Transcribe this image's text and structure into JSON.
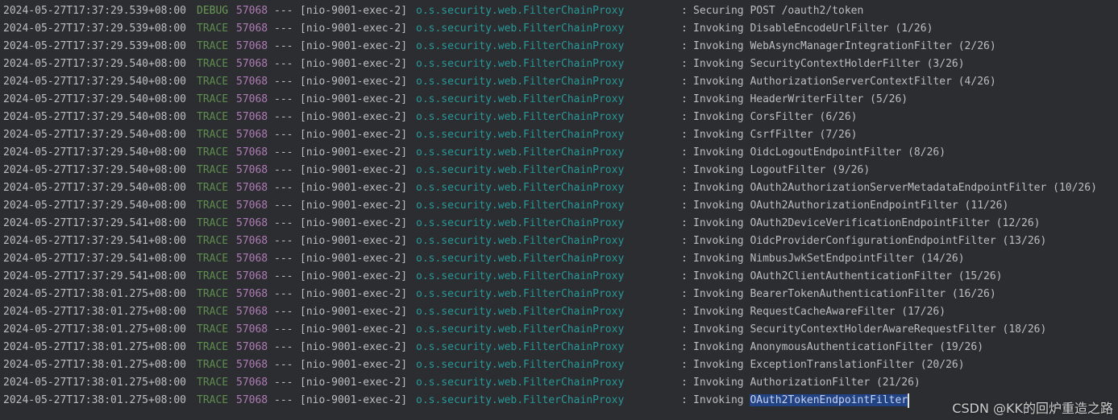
{
  "console": {
    "lines": [
      {
        "timestamp": "2024-05-27T17:37:29.539+08:00",
        "level": "DEBUG",
        "pid": "57068",
        "sep": "---",
        "thread": "[nio-9001-exec-2]",
        "logger": "o.s.security.web.FilterChainProxy",
        "colon": ":",
        "message": "Securing POST /oauth2/token"
      },
      {
        "timestamp": "2024-05-27T17:37:29.539+08:00",
        "level": "TRACE",
        "pid": "57068",
        "sep": "---",
        "thread": "[nio-9001-exec-2]",
        "logger": "o.s.security.web.FilterChainProxy",
        "colon": ":",
        "message": "Invoking DisableEncodeUrlFilter (1/26)"
      },
      {
        "timestamp": "2024-05-27T17:37:29.539+08:00",
        "level": "TRACE",
        "pid": "57068",
        "sep": "---",
        "thread": "[nio-9001-exec-2]",
        "logger": "o.s.security.web.FilterChainProxy",
        "colon": ":",
        "message": "Invoking WebAsyncManagerIntegrationFilter (2/26)"
      },
      {
        "timestamp": "2024-05-27T17:37:29.540+08:00",
        "level": "TRACE",
        "pid": "57068",
        "sep": "---",
        "thread": "[nio-9001-exec-2]",
        "logger": "o.s.security.web.FilterChainProxy",
        "colon": ":",
        "message": "Invoking SecurityContextHolderFilter (3/26)"
      },
      {
        "timestamp": "2024-05-27T17:37:29.540+08:00",
        "level": "TRACE",
        "pid": "57068",
        "sep": "---",
        "thread": "[nio-9001-exec-2]",
        "logger": "o.s.security.web.FilterChainProxy",
        "colon": ":",
        "message": "Invoking AuthorizationServerContextFilter (4/26)"
      },
      {
        "timestamp": "2024-05-27T17:37:29.540+08:00",
        "level": "TRACE",
        "pid": "57068",
        "sep": "---",
        "thread": "[nio-9001-exec-2]",
        "logger": "o.s.security.web.FilterChainProxy",
        "colon": ":",
        "message": "Invoking HeaderWriterFilter (5/26)"
      },
      {
        "timestamp": "2024-05-27T17:37:29.540+08:00",
        "level": "TRACE",
        "pid": "57068",
        "sep": "---",
        "thread": "[nio-9001-exec-2]",
        "logger": "o.s.security.web.FilterChainProxy",
        "colon": ":",
        "message": "Invoking CorsFilter (6/26)"
      },
      {
        "timestamp": "2024-05-27T17:37:29.540+08:00",
        "level": "TRACE",
        "pid": "57068",
        "sep": "---",
        "thread": "[nio-9001-exec-2]",
        "logger": "o.s.security.web.FilterChainProxy",
        "colon": ":",
        "message": "Invoking CsrfFilter (7/26)"
      },
      {
        "timestamp": "2024-05-27T17:37:29.540+08:00",
        "level": "TRACE",
        "pid": "57068",
        "sep": "---",
        "thread": "[nio-9001-exec-2]",
        "logger": "o.s.security.web.FilterChainProxy",
        "colon": ":",
        "message": "Invoking OidcLogoutEndpointFilter (8/26)"
      },
      {
        "timestamp": "2024-05-27T17:37:29.540+08:00",
        "level": "TRACE",
        "pid": "57068",
        "sep": "---",
        "thread": "[nio-9001-exec-2]",
        "logger": "o.s.security.web.FilterChainProxy",
        "colon": ":",
        "message": "Invoking LogoutFilter (9/26)"
      },
      {
        "timestamp": "2024-05-27T17:37:29.540+08:00",
        "level": "TRACE",
        "pid": "57068",
        "sep": "---",
        "thread": "[nio-9001-exec-2]",
        "logger": "o.s.security.web.FilterChainProxy",
        "colon": ":",
        "message": "Invoking OAuth2AuthorizationServerMetadataEndpointFilter (10/26)"
      },
      {
        "timestamp": "2024-05-27T17:37:29.540+08:00",
        "level": "TRACE",
        "pid": "57068",
        "sep": "---",
        "thread": "[nio-9001-exec-2]",
        "logger": "o.s.security.web.FilterChainProxy",
        "colon": ":",
        "message": "Invoking OAuth2AuthorizationEndpointFilter (11/26)"
      },
      {
        "timestamp": "2024-05-27T17:37:29.541+08:00",
        "level": "TRACE",
        "pid": "57068",
        "sep": "---",
        "thread": "[nio-9001-exec-2]",
        "logger": "o.s.security.web.FilterChainProxy",
        "colon": ":",
        "message": "Invoking OAuth2DeviceVerificationEndpointFilter (12/26)"
      },
      {
        "timestamp": "2024-05-27T17:37:29.541+08:00",
        "level": "TRACE",
        "pid": "57068",
        "sep": "---",
        "thread": "[nio-9001-exec-2]",
        "logger": "o.s.security.web.FilterChainProxy",
        "colon": ":",
        "message": "Invoking OidcProviderConfigurationEndpointFilter (13/26)"
      },
      {
        "timestamp": "2024-05-27T17:37:29.541+08:00",
        "level": "TRACE",
        "pid": "57068",
        "sep": "---",
        "thread": "[nio-9001-exec-2]",
        "logger": "o.s.security.web.FilterChainProxy",
        "colon": ":",
        "message": "Invoking NimbusJwkSetEndpointFilter (14/26)"
      },
      {
        "timestamp": "2024-05-27T17:37:29.541+08:00",
        "level": "TRACE",
        "pid": "57068",
        "sep": "---",
        "thread": "[nio-9001-exec-2]",
        "logger": "o.s.security.web.FilterChainProxy",
        "colon": ":",
        "message": "Invoking OAuth2ClientAuthenticationFilter (15/26)"
      },
      {
        "timestamp": "2024-05-27T17:38:01.275+08:00",
        "level": "TRACE",
        "pid": "57068",
        "sep": "---",
        "thread": "[nio-9001-exec-2]",
        "logger": "o.s.security.web.FilterChainProxy",
        "colon": ":",
        "message": "Invoking BearerTokenAuthenticationFilter (16/26)"
      },
      {
        "timestamp": "2024-05-27T17:38:01.275+08:00",
        "level": "TRACE",
        "pid": "57068",
        "sep": "---",
        "thread": "[nio-9001-exec-2]",
        "logger": "o.s.security.web.FilterChainProxy",
        "colon": ":",
        "message": "Invoking RequestCacheAwareFilter (17/26)"
      },
      {
        "timestamp": "2024-05-27T17:38:01.275+08:00",
        "level": "TRACE",
        "pid": "57068",
        "sep": "---",
        "thread": "[nio-9001-exec-2]",
        "logger": "o.s.security.web.FilterChainProxy",
        "colon": ":",
        "message": "Invoking SecurityContextHolderAwareRequestFilter (18/26)"
      },
      {
        "timestamp": "2024-05-27T17:38:01.275+08:00",
        "level": "TRACE",
        "pid": "57068",
        "sep": "---",
        "thread": "[nio-9001-exec-2]",
        "logger": "o.s.security.web.FilterChainProxy",
        "colon": ":",
        "message": "Invoking AnonymousAuthenticationFilter (19/26)"
      },
      {
        "timestamp": "2024-05-27T17:38:01.275+08:00",
        "level": "TRACE",
        "pid": "57068",
        "sep": "---",
        "thread": "[nio-9001-exec-2]",
        "logger": "o.s.security.web.FilterChainProxy",
        "colon": ":",
        "message": "Invoking ExceptionTranslationFilter (20/26)"
      },
      {
        "timestamp": "2024-05-27T17:38:01.275+08:00",
        "level": "TRACE",
        "pid": "57068",
        "sep": "---",
        "thread": "[nio-9001-exec-2]",
        "logger": "o.s.security.web.FilterChainProxy",
        "colon": ":",
        "message": "Invoking AuthorizationFilter (21/26)"
      },
      {
        "timestamp": "2024-05-27T17:38:01.275+08:00",
        "level": "TRACE",
        "pid": "57068",
        "sep": "---",
        "thread": "[nio-9001-exec-2]",
        "logger": "o.s.security.web.FilterChainProxy",
        "colon": ":",
        "message_prefix": "Invoking ",
        "message_selected": "OAuth2TokenEndpointFilter",
        "selected": true
      }
    ]
  },
  "watermark": {
    "text": "CSDN @KK的回炉重造之路"
  },
  "colors": {
    "background": "#2b2d30",
    "text": "#bcbec4",
    "trace": "#5f8c4f",
    "debug": "#6a9955",
    "pid": "#b07bb5",
    "logger": "#299999",
    "selection": "#214283"
  }
}
